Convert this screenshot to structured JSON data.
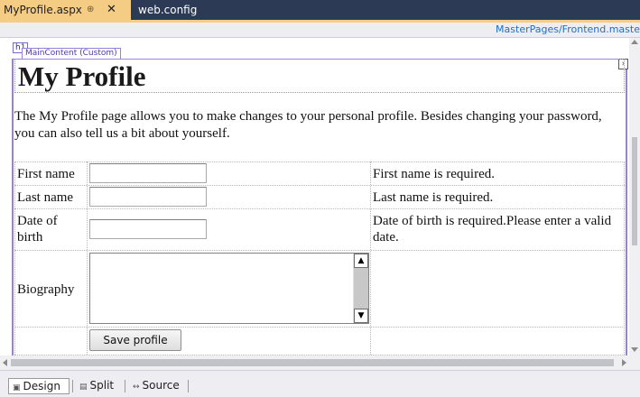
{
  "tabs": [
    {
      "label": "MyProfile.aspx",
      "pin": "⊕",
      "close": "✕",
      "active": true
    },
    {
      "label": "web.config",
      "active": false
    }
  ],
  "path": "MasterPages/Frontend.maste",
  "designer": {
    "h1_tag": "h1",
    "region_tag": "MainContent (Custom)",
    "expander": "›"
  },
  "page": {
    "title": "My Profile",
    "intro": "The My Profile page allows you to make changes to your personal profile. Besides changing your password, you can also tell us a bit about yourself."
  },
  "form": {
    "first_name_label": "First name",
    "first_name_value": "",
    "first_name_error": "First name is required.",
    "last_name_label": "Last name",
    "last_name_value": "",
    "last_name_error": "Last name is required.",
    "dob_label": "Date of birth",
    "dob_value": "",
    "dob_error": "Date of birth is required.Please enter a valid date.",
    "bio_label": "Biography",
    "bio_value": "",
    "save_label": "Save profile"
  },
  "view_switcher": {
    "design": "Design",
    "split": "Split",
    "source": "Source",
    "active": "Design"
  },
  "colors": {
    "active_tab": "#f5cc84",
    "tab_strip": "#2d3a56",
    "region_border": "#9b7fe0",
    "path_link": "#1e6fc7"
  }
}
